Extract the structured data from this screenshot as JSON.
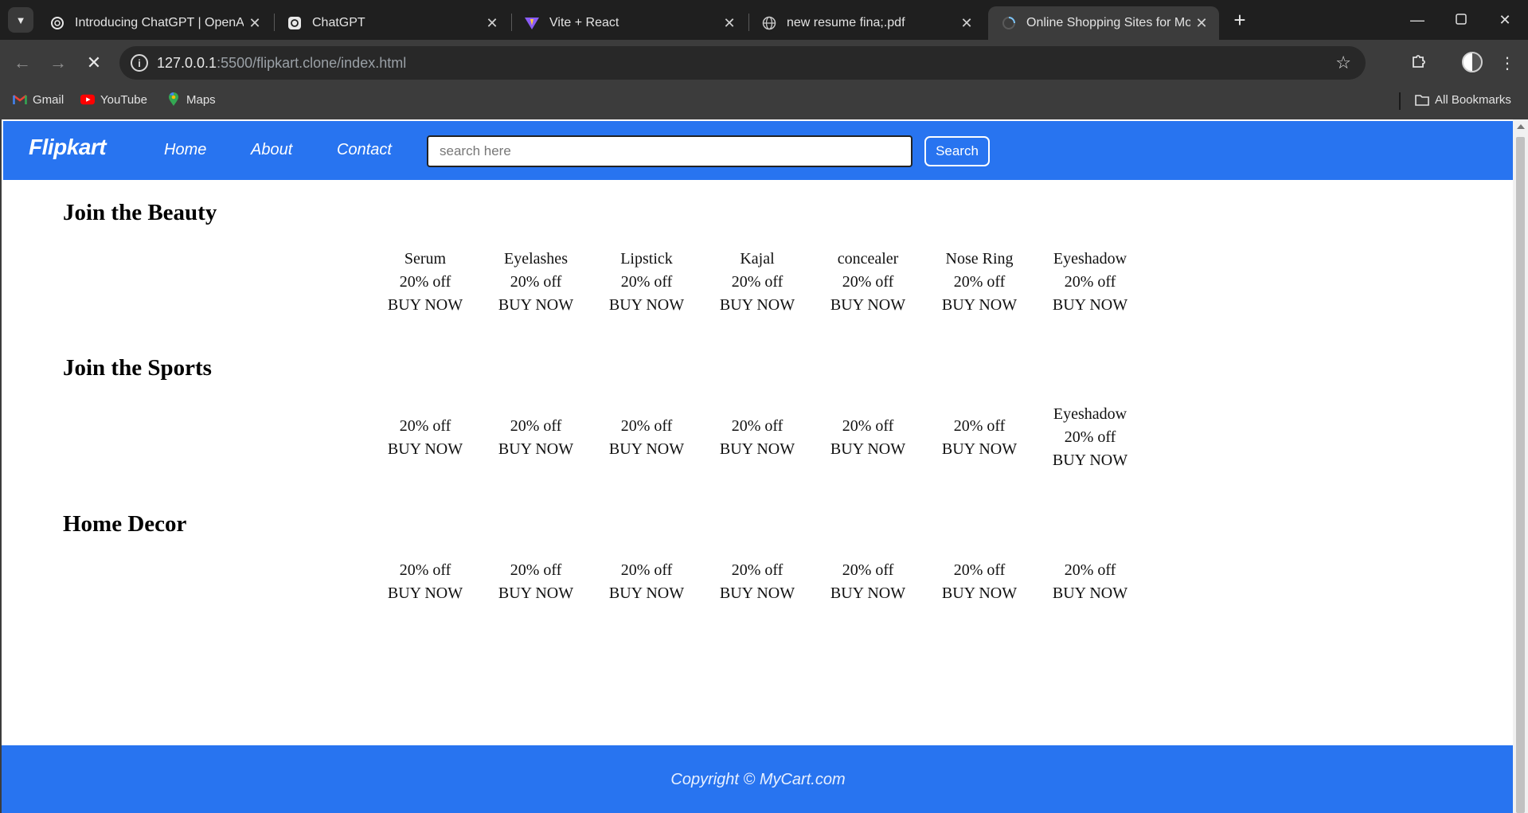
{
  "browser": {
    "tabs": [
      {
        "title": "Introducing ChatGPT | OpenAI",
        "icon": "openai-icon"
      },
      {
        "title": "ChatGPT",
        "icon": "chatgpt-icon"
      },
      {
        "title": "Vite + React",
        "icon": "vite-icon"
      },
      {
        "title": "new resume fina;.pdf",
        "icon": "globe-icon"
      },
      {
        "title": "Online Shopping Sites for Mobi",
        "icon": "loading-icon",
        "active": true
      }
    ],
    "url_host": "127.0.0.1",
    "url_rest": ":5500/flipkart.clone/index.html",
    "bookmarks": [
      {
        "label": "Gmail",
        "icon": "gmail-icon"
      },
      {
        "label": "YouTube",
        "icon": "youtube-icon"
      },
      {
        "label": "Maps",
        "icon": "maps-icon"
      }
    ],
    "all_bookmarks": "All Bookmarks"
  },
  "site": {
    "brand": "Flipkart",
    "nav": [
      "Home",
      "About",
      "Contact"
    ],
    "search_placeholder": "search here",
    "search_button": "Search",
    "brand_color": "#2874f0"
  },
  "sections": [
    {
      "title": "Join the Beauty",
      "products": [
        {
          "name": "Serum",
          "discount": "20% off",
          "cta": "BUY NOW"
        },
        {
          "name": "Eyelashes",
          "discount": "20% off",
          "cta": "BUY NOW"
        },
        {
          "name": "Lipstick",
          "discount": "20% off",
          "cta": "BUY NOW"
        },
        {
          "name": "Kajal",
          "discount": "20% off",
          "cta": "BUY NOW"
        },
        {
          "name": "concealer",
          "discount": "20% off",
          "cta": "BUY NOW"
        },
        {
          "name": "Nose Ring",
          "discount": "20% off",
          "cta": "BUY NOW"
        },
        {
          "name": "Eyeshadow",
          "discount": "20% off",
          "cta": "BUY NOW"
        }
      ]
    },
    {
      "title": "Join the Sports",
      "products": [
        {
          "name": "",
          "discount": "20% off",
          "cta": "BUY NOW"
        },
        {
          "name": "",
          "discount": "20% off",
          "cta": "BUY NOW"
        },
        {
          "name": "",
          "discount": "20% off",
          "cta": "BUY NOW"
        },
        {
          "name": "",
          "discount": "20% off",
          "cta": "BUY NOW"
        },
        {
          "name": "",
          "discount": "20% off",
          "cta": "BUY NOW"
        },
        {
          "name": "",
          "discount": "20% off",
          "cta": "BUY NOW"
        },
        {
          "name": "Eyeshadow",
          "discount": "20% off",
          "cta": "BUY NOW"
        }
      ]
    },
    {
      "title": "Home Decor",
      "products": [
        {
          "name": "",
          "discount": "20% off",
          "cta": "BUY NOW"
        },
        {
          "name": "",
          "discount": "20% off",
          "cta": "BUY NOW"
        },
        {
          "name": "",
          "discount": "20% off",
          "cta": "BUY NOW"
        },
        {
          "name": "",
          "discount": "20% off",
          "cta": "BUY NOW"
        },
        {
          "name": "",
          "discount": "20% off",
          "cta": "BUY NOW"
        },
        {
          "name": "",
          "discount": "20% off",
          "cta": "BUY NOW"
        },
        {
          "name": "",
          "discount": "20% off",
          "cta": "BUY NOW"
        }
      ]
    }
  ],
  "footer": {
    "text": "Copyright © MyCart.com"
  }
}
